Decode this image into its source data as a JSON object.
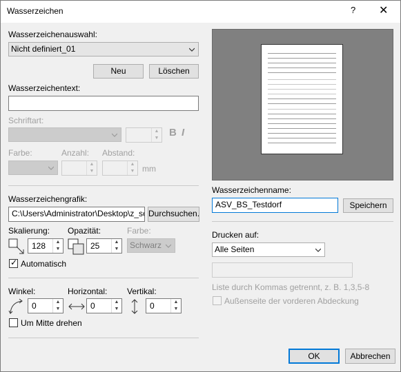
{
  "window": {
    "title": "Wasserzeichen",
    "help_glyph": "?",
    "close_glyph": "✕"
  },
  "selection": {
    "label": "Wasserzeichenauswahl:",
    "value": "Nicht definiert_01",
    "new_label": "Neu",
    "delete_label": "Löschen"
  },
  "text_section": {
    "label": "Wasserzeichentext:",
    "value": "",
    "font_label": "Schriftart:",
    "bold_glyph": "B",
    "italic_glyph": "I",
    "color_label": "Farbe:",
    "count_label": "Anzahl:",
    "spacing_label": "Abstand:",
    "unit": "mm"
  },
  "graphic": {
    "label": "Wasserzeichengrafik:",
    "path": "C:\\Users\\Administrator\\Desktop\\z_sc",
    "browse_label": "Durchsuchen...",
    "scale_label": "Skalierung:",
    "scale_value": "128",
    "opacity_label": "Opazität:",
    "opacity_value": "25",
    "color_label": "Farbe:",
    "color_value": "Schwarz",
    "auto_label": "Automatisch",
    "auto_checked": true
  },
  "transform": {
    "angle_label": "Winkel:",
    "angle_value": "0",
    "horizontal_label": "Horizontal:",
    "horizontal_value": "0",
    "vertical_label": "Vertikal:",
    "vertical_value": "0",
    "rotate_center_label": "Um Mitte drehen",
    "rotate_center_checked": false
  },
  "save": {
    "name_label": "Wasserzeichenname:",
    "name_value": "ASV_BS_Testdorf",
    "save_label": "Speichern"
  },
  "print": {
    "label": "Drucken auf:",
    "value": "Alle Seiten",
    "pages_value": "",
    "hint": "Liste durch Kommas getrennt, z. B. 1,3,5-8",
    "outside_label": "Außenseite der vorderen Abdeckung",
    "outside_checked": false
  },
  "footer": {
    "ok_label": "OK",
    "cancel_label": "Abbrechen"
  }
}
